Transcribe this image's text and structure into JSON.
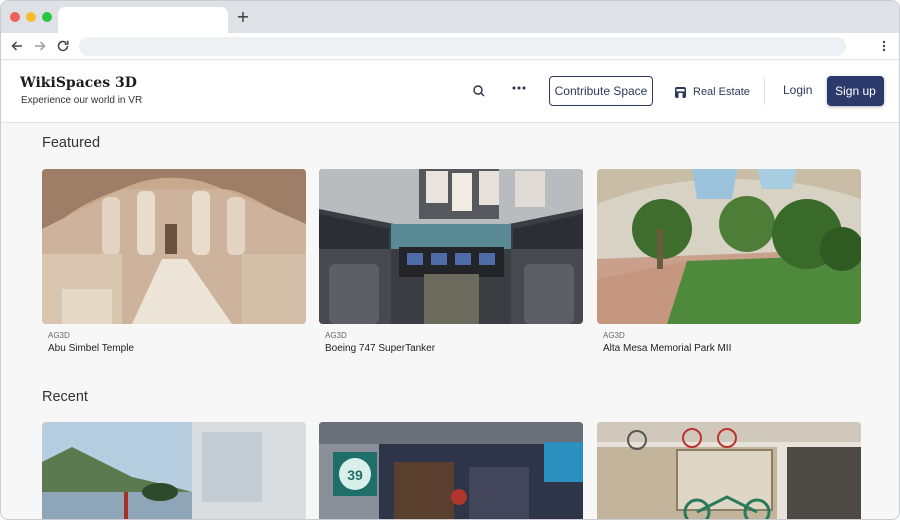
{
  "browser": {
    "new_tab_label": "+",
    "back_icon": "arrow-left-icon",
    "forward_icon": "arrow-right-icon",
    "reload_icon": "reload-icon",
    "menu_icon": "kebab-menu-icon"
  },
  "header": {
    "brand": "WikiSpaces 3D",
    "tagline": "Experience our world in VR",
    "contribute_label": "Contribute Space",
    "real_estate_label": "Real Estate",
    "login_label": "Login",
    "signup_label": "Sign up",
    "accent_color": "#2b3a6b"
  },
  "featured": {
    "title": "Featured",
    "cards": [
      {
        "source": "AG3D",
        "title": "Abu Simbel Temple"
      },
      {
        "source": "AG3D",
        "title": "Boeing 747 SuperTanker"
      },
      {
        "source": "AG3D",
        "title": "Alta Mesa Memorial Park MII"
      }
    ]
  },
  "recent": {
    "title": "Recent",
    "thumb_sign_number": "39"
  }
}
